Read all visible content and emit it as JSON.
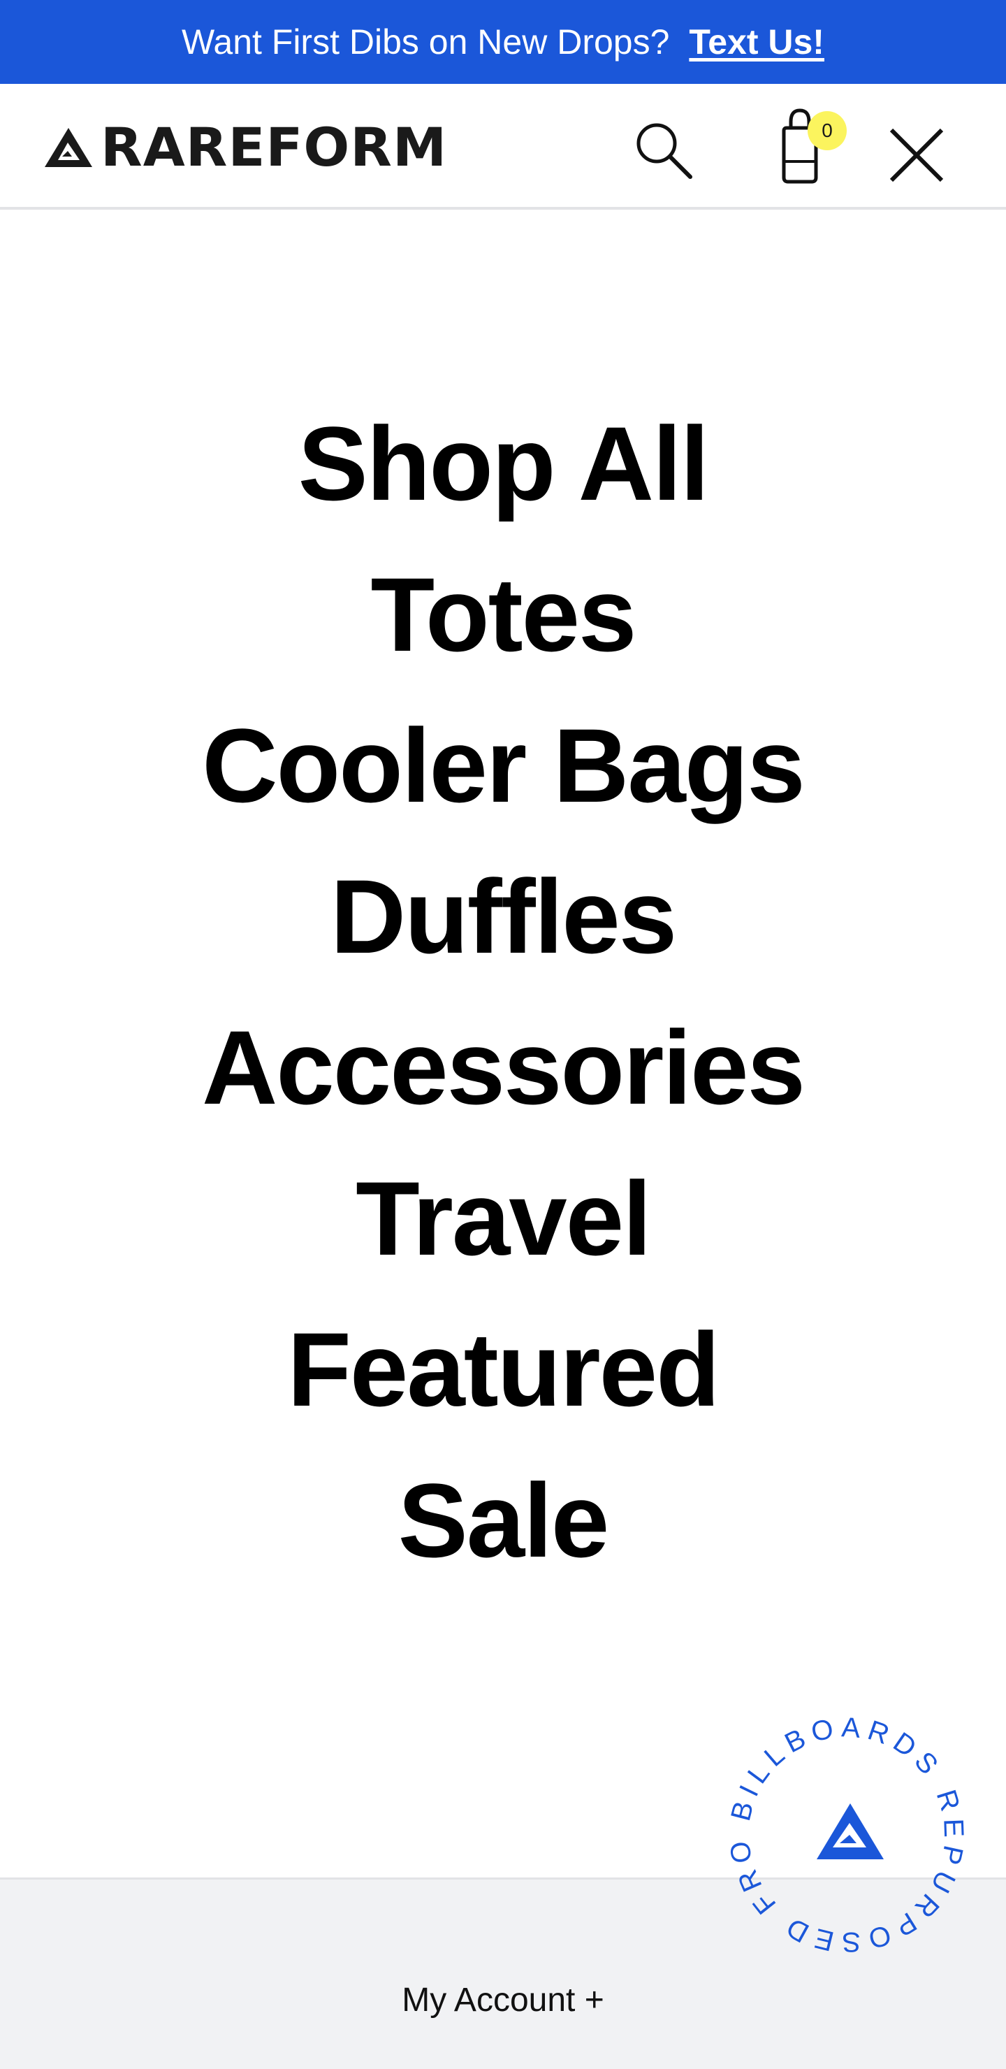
{
  "promo": {
    "text": "Want First Dibs on New Drops?",
    "link": "Text Us!"
  },
  "header": {
    "logo_text": "RAREFORM",
    "cart_count": "0",
    "icons": [
      "search-icon",
      "shopping-bag-icon",
      "close-icon"
    ]
  },
  "menu": {
    "items": [
      {
        "label": "Shop All"
      },
      {
        "label": "Totes"
      },
      {
        "label": "Cooler Bags"
      },
      {
        "label": "Duffles"
      },
      {
        "label": "Accessories"
      },
      {
        "label": "Travel"
      },
      {
        "label": "Featured"
      },
      {
        "label": "Sale"
      }
    ]
  },
  "footer": {
    "account_label": "My Account +"
  },
  "badge": {
    "text": "BILLBOARDS REPURPOSED FROM"
  },
  "colors": {
    "brand_blue": "#1b57d9",
    "cart_badge": "#fbf45e",
    "footer_bg": "#f1f2f4"
  }
}
